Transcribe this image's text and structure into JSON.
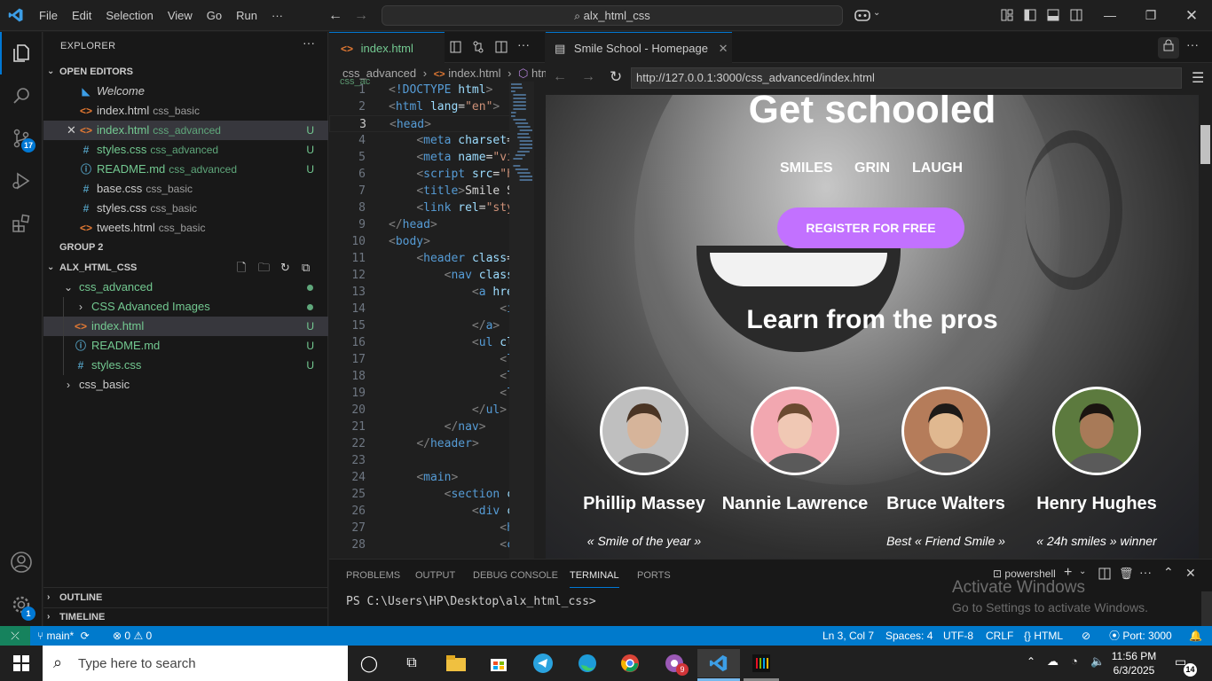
{
  "menu": [
    "File",
    "Edit",
    "Selection",
    "View",
    "Go",
    "Run",
    "···"
  ],
  "search_box": "alx_html_css",
  "sidebar": {
    "title": "EXPLORER",
    "open_editors_label": "OPEN EDITORS",
    "open_editors": [
      {
        "name": "Welcome",
        "desc": "",
        "status": "",
        "icon": "vscode-icon",
        "italic": true
      },
      {
        "name": "index.html",
        "desc": "css_basic",
        "status": "",
        "icon": "html-icon"
      },
      {
        "name": "index.html",
        "desc": "css_advanced",
        "status": "U",
        "icon": "html-icon",
        "active": true
      },
      {
        "name": "styles.css",
        "desc": "css_advanced",
        "status": "U",
        "icon": "css-icon"
      },
      {
        "name": "README.md",
        "desc": "css_advanced",
        "status": "U",
        "icon": "info-icon"
      },
      {
        "name": "base.css",
        "desc": "css_basic",
        "status": "",
        "icon": "css-icon"
      },
      {
        "name": "styles.css",
        "desc": "css_basic",
        "status": "",
        "icon": "css-icon"
      },
      {
        "name": "tweets.html",
        "desc": "css_basic",
        "status": "",
        "icon": "html-icon"
      }
    ],
    "group2_label": "GROUP 2",
    "project_label": "ALX_HTML_CSS",
    "tree": [
      {
        "name": "css_advanced",
        "depth": 1,
        "folder": "open",
        "status": "dot"
      },
      {
        "name": "CSS Advanced Images",
        "depth": 2,
        "folder": "closed",
        "status": "dot"
      },
      {
        "name": "index.html",
        "depth": 2,
        "icon": "html-icon",
        "status": "U",
        "selected": true
      },
      {
        "name": "README.md",
        "depth": 2,
        "icon": "info-icon",
        "status": "U"
      },
      {
        "name": "styles.css",
        "depth": 2,
        "icon": "css-icon",
        "status": "U"
      },
      {
        "name": "css_basic",
        "depth": 1,
        "folder": "closed",
        "status": ""
      }
    ],
    "outline_label": "OUTLINE",
    "timeline_label": "TIMELINE"
  },
  "editor": {
    "tab_label": "index.html",
    "tab_desc": "css_ac",
    "breadcrumb": [
      "css_advanced",
      "index.html",
      "htm"
    ],
    "active_line": 3,
    "lines": [
      [
        [
          "br",
          "<"
        ],
        [
          "tg",
          "!DOCTYPE "
        ],
        [
          "at",
          "html"
        ],
        [
          "br",
          ">"
        ]
      ],
      [
        [
          "br",
          "<"
        ],
        [
          "tg",
          "html "
        ],
        [
          "at",
          "lang"
        ],
        [
          "tx",
          "="
        ],
        [
          "st",
          "\"en\""
        ],
        [
          "br",
          ">"
        ]
      ],
      [
        [
          "br",
          "<"
        ],
        [
          "tg",
          "head"
        ],
        [
          "br",
          ">"
        ]
      ],
      [
        [
          "tx",
          "    "
        ],
        [
          "br",
          "<"
        ],
        [
          "tg",
          "meta "
        ],
        [
          "at",
          "charset"
        ],
        [
          "tx",
          "="
        ]
      ],
      [
        [
          "tx",
          "    "
        ],
        [
          "br",
          "<"
        ],
        [
          "tg",
          "meta "
        ],
        [
          "at",
          "name"
        ],
        [
          "tx",
          "="
        ],
        [
          "st",
          "\"vi"
        ]
      ],
      [
        [
          "tx",
          "    "
        ],
        [
          "br",
          "<"
        ],
        [
          "tg",
          "script "
        ],
        [
          "at",
          "src"
        ],
        [
          "tx",
          "="
        ],
        [
          "st",
          "\"h"
        ]
      ],
      [
        [
          "tx",
          "    "
        ],
        [
          "br",
          "<"
        ],
        [
          "tg",
          "title"
        ],
        [
          "br",
          ">"
        ],
        [
          "tx",
          "Smile S"
        ]
      ],
      [
        [
          "tx",
          "    "
        ],
        [
          "br",
          "<"
        ],
        [
          "tg",
          "link "
        ],
        [
          "at",
          "rel"
        ],
        [
          "tx",
          "="
        ],
        [
          "st",
          "\"sty"
        ]
      ],
      [
        [
          "br",
          "</"
        ],
        [
          "tg",
          "head"
        ],
        [
          "br",
          ">"
        ]
      ],
      [
        [
          "br",
          "<"
        ],
        [
          "tg",
          "body"
        ],
        [
          "br",
          ">"
        ]
      ],
      [
        [
          "tx",
          "    "
        ],
        [
          "br",
          "<"
        ],
        [
          "tg",
          "header "
        ],
        [
          "at",
          "class"
        ],
        [
          "tx",
          "="
        ]
      ],
      [
        [
          "tx",
          "        "
        ],
        [
          "br",
          "<"
        ],
        [
          "tg",
          "nav "
        ],
        [
          "at",
          "class"
        ]
      ],
      [
        [
          "tx",
          "            "
        ],
        [
          "br",
          "<"
        ],
        [
          "tg",
          "a "
        ],
        [
          "at",
          "hre"
        ]
      ],
      [
        [
          "tx",
          "                "
        ],
        [
          "br",
          "<"
        ],
        [
          "tg",
          "i"
        ]
      ],
      [
        [
          "tx",
          "            "
        ],
        [
          "br",
          "</"
        ],
        [
          "tg",
          "a"
        ],
        [
          "br",
          ">"
        ]
      ],
      [
        [
          "tx",
          "            "
        ],
        [
          "br",
          "<"
        ],
        [
          "tg",
          "ul "
        ],
        [
          "at",
          "cl"
        ]
      ],
      [
        [
          "tx",
          "                "
        ],
        [
          "br",
          "<"
        ],
        [
          "tg",
          "l"
        ]
      ],
      [
        [
          "tx",
          "                "
        ],
        [
          "br",
          "<"
        ],
        [
          "tg",
          "l"
        ]
      ],
      [
        [
          "tx",
          "                "
        ],
        [
          "br",
          "<"
        ],
        [
          "tg",
          "l"
        ]
      ],
      [
        [
          "tx",
          "            "
        ],
        [
          "br",
          "</"
        ],
        [
          "tg",
          "ul"
        ],
        [
          "br",
          ">"
        ]
      ],
      [
        [
          "tx",
          "        "
        ],
        [
          "br",
          "</"
        ],
        [
          "tg",
          "nav"
        ],
        [
          "br",
          ">"
        ]
      ],
      [
        [
          "tx",
          "    "
        ],
        [
          "br",
          "</"
        ],
        [
          "tg",
          "header"
        ],
        [
          "br",
          ">"
        ]
      ],
      [],
      [
        [
          "tx",
          "    "
        ],
        [
          "br",
          "<"
        ],
        [
          "tg",
          "main"
        ],
        [
          "br",
          ">"
        ]
      ],
      [
        [
          "tx",
          "        "
        ],
        [
          "br",
          "<"
        ],
        [
          "tg",
          "section "
        ],
        [
          "at",
          "c"
        ]
      ],
      [
        [
          "tx",
          "            "
        ],
        [
          "br",
          "<"
        ],
        [
          "tg",
          "div "
        ],
        [
          "at",
          "c"
        ]
      ],
      [
        [
          "tx",
          "                "
        ],
        [
          "br",
          "<"
        ],
        [
          "tg",
          "h"
        ]
      ],
      [
        [
          "tx",
          "                "
        ],
        [
          "br",
          "<"
        ],
        [
          "tg",
          "c"
        ]
      ]
    ]
  },
  "browser": {
    "tab_title": "Smile School - Homepage",
    "url": "http://127.0.0.1:3000/css_advanced/index.html",
    "hero_title": "Get schooled",
    "nav_links": [
      "SMILES",
      "GRIN",
      "LAUGH"
    ],
    "cta_label": "REGISTER FOR FREE",
    "section_title": "Learn from the pros",
    "profiles": [
      {
        "name": "Phillip Massey",
        "quote": "« Smile of the year »",
        "skin": "#d6b49a",
        "bg": "#bfbfbf",
        "hair": "#4a3424"
      },
      {
        "name": "Nannie Lawrence",
        "quote": "",
        "skin": "#f0c8b4",
        "bg": "#f2a7b0",
        "hair": "#6b4a30"
      },
      {
        "name": "Bruce Walters",
        "quote": "Best « Friend Smile »",
        "skin": "#e0b890",
        "bg": "#b57c5a",
        "hair": "#1d1a18"
      },
      {
        "name": "Henry Hughes",
        "quote": "« 24h smiles » winner",
        "skin": "#a87a58",
        "bg": "#5c7a3e",
        "hair": "#1a1410"
      }
    ],
    "brand_color": "#c271ff"
  },
  "panel": {
    "tabs": [
      "PROBLEMS",
      "OUTPUT",
      "DEBUG CONSOLE",
      "TERMINAL",
      "PORTS"
    ],
    "active_tab": "TERMINAL",
    "shell_label": "powershell",
    "prompt": "PS C:\\Users\\HP\\Desktop\\alx_html_css>",
    "watermark_title": "Activate Windows",
    "watermark_sub": "Go to Settings to activate Windows."
  },
  "statusbar": {
    "branch": "main*",
    "errors": "0",
    "warnings": "0",
    "position": "Ln 3, Col 7",
    "spaces": "Spaces: 4",
    "encoding": "UTF-8",
    "eol": "CRLF",
    "language": "HTML",
    "port": "Port: 3000"
  },
  "activity": {
    "scm_badge": "17",
    "settings_badge": "1"
  },
  "taskbar": {
    "search_placeholder": "Type here to search",
    "time": "11:56 PM",
    "date": "6/3/2025",
    "notif_count": "14",
    "chrome_badge": "9"
  }
}
